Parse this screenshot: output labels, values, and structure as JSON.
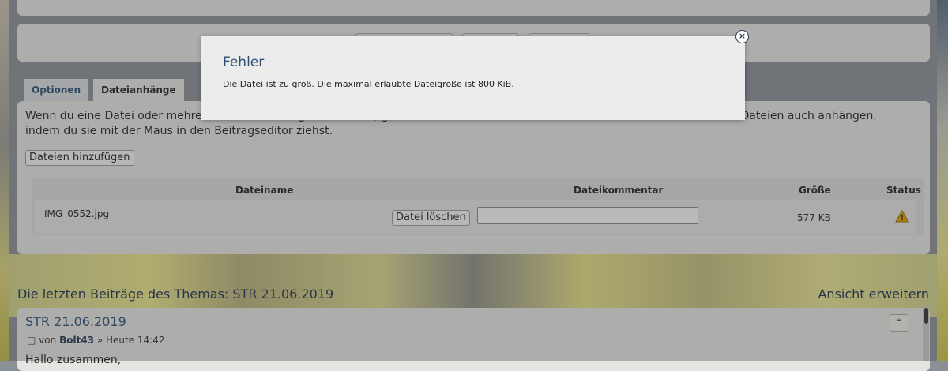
{
  "modal": {
    "title": "Fehler",
    "message": "Die Datei ist zu groß. Die maximal erlaubte Dateigröße ist 800 KiB.",
    "close_icon": "close-icon"
  },
  "tabs": [
    {
      "label": "Optionen"
    },
    {
      "label": "Dateianhänge"
    }
  ],
  "attachments": {
    "help_text": "Wenn du eine Datei oder mehrere Dateien anhängen möchtest, gib den Dateinamen ein oder ziehe sie in dieses Feld. Du kannst Dateien auch anhängen, indem du sie mit der Maus in den Beitragseditor ziehst.",
    "add_button": "Dateien hinzufügen",
    "columns": [
      "Dateiname",
      "Dateikommentar",
      "Größe",
      "Status"
    ],
    "rows": [
      {
        "filename": "IMG_0552.jpg",
        "delete_label": "Datei löschen",
        "comment": "",
        "size": "577 KB",
        "status_icon": "warning-icon"
      }
    ]
  },
  "recent": {
    "title": "Die letzten Beiträge des Themas: STR 21.06.2019",
    "expand_link": "Ansicht erweitern",
    "post": {
      "title": "STR 21.06.2019",
      "by": "von",
      "author": "Bolt43",
      "time": "» Heute 14:42",
      "body": "Hallo zusammen,"
    }
  },
  "colors": {
    "accent": "#2d4f74",
    "warning": "#e0a300"
  }
}
